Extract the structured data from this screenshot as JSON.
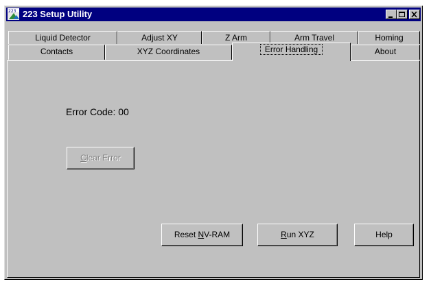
{
  "window": {
    "icon_text": "223",
    "title": "223 Setup Utility"
  },
  "tabs": {
    "back_row": [
      "Liquid Detector",
      "Adjust XY",
      "Z Arm",
      "Arm Travel",
      "Homing"
    ],
    "front_row": [
      "Contacts",
      "XYZ Coordinates",
      "Error Handling",
      "About"
    ],
    "active": "Error Handling"
  },
  "panel": {
    "error_code_text": "Error Code: 00",
    "clear_error": {
      "mnemonic": "C",
      "rest": "lear Error",
      "enabled": false
    },
    "reset_nvram": {
      "before": "Reset ",
      "mnemonic": "N",
      "rest": "V-RAM"
    },
    "run_xyz": {
      "mnemonic": "R",
      "rest": "un XYZ"
    },
    "help": {
      "label": "Help"
    }
  },
  "colors": {
    "face": "#c0c0c0",
    "titlebar": "#000080",
    "disabled_text": "#808080"
  },
  "icons": [
    "app-223-icon",
    "minimize-icon",
    "maximize-icon",
    "close-icon"
  ]
}
